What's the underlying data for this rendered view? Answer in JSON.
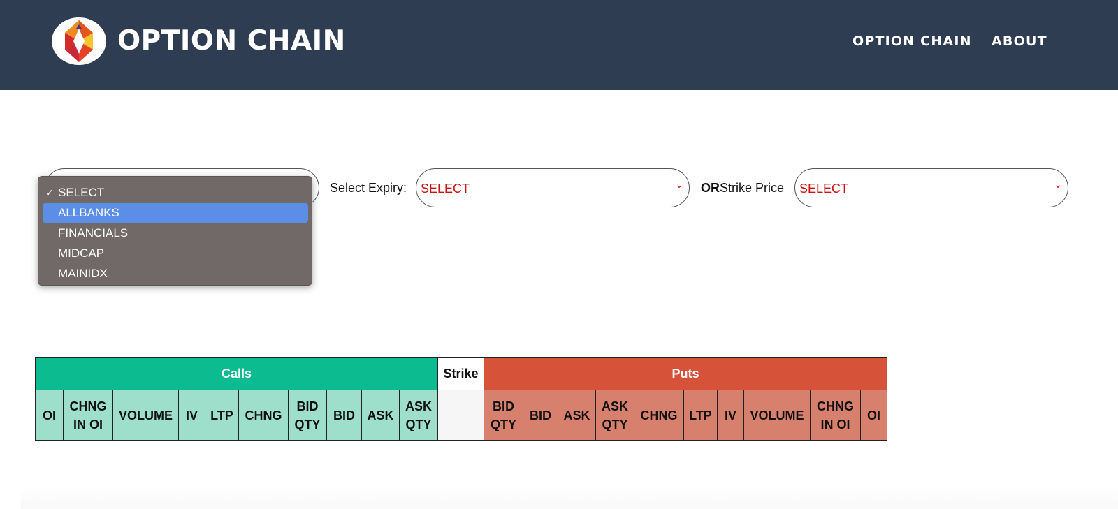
{
  "header": {
    "brand": "OPTION CHAIN",
    "nav": [
      {
        "label": "OPTION CHAIN"
      },
      {
        "label": "ABOUT"
      }
    ]
  },
  "filters": {
    "symbol_select": {
      "value": "SELECT"
    },
    "expiry_label": "Select Expiry:",
    "expiry_select": {
      "value": "SELECT"
    },
    "or_label": "OR",
    "strike_label": "Strike Price",
    "strike_select": {
      "value": "SELECT"
    }
  },
  "dropdown": {
    "options": [
      "SELECT",
      "ALLBANKS",
      "FINANCIALS",
      "MIDCAP",
      "MAINIDX"
    ],
    "checked": "SELECT",
    "highlighted": "ALLBANKS",
    "check_glyph": "✓"
  },
  "table": {
    "calls_label": "Calls",
    "strike_label": "Strike",
    "puts_label": "Puts",
    "calls_columns": [
      "OI",
      "CHNG IN OI",
      "VOLUME",
      "IV",
      "LTP",
      "CHNG",
      "BID QTY",
      "BID",
      "ASK",
      "ASK QTY"
    ],
    "puts_columns": [
      "BID QTY",
      "BID",
      "ASK",
      "ASK QTY",
      "CHNG",
      "LTP",
      "IV",
      "VOLUME",
      "CHNG IN OI",
      "OI"
    ]
  },
  "colors": {
    "header_bg": "#2e3d52",
    "calls": "#0dbb90",
    "puts": "#d65239",
    "select_text": "#cc1111",
    "dropdown_highlight": "#5b8ee6"
  }
}
